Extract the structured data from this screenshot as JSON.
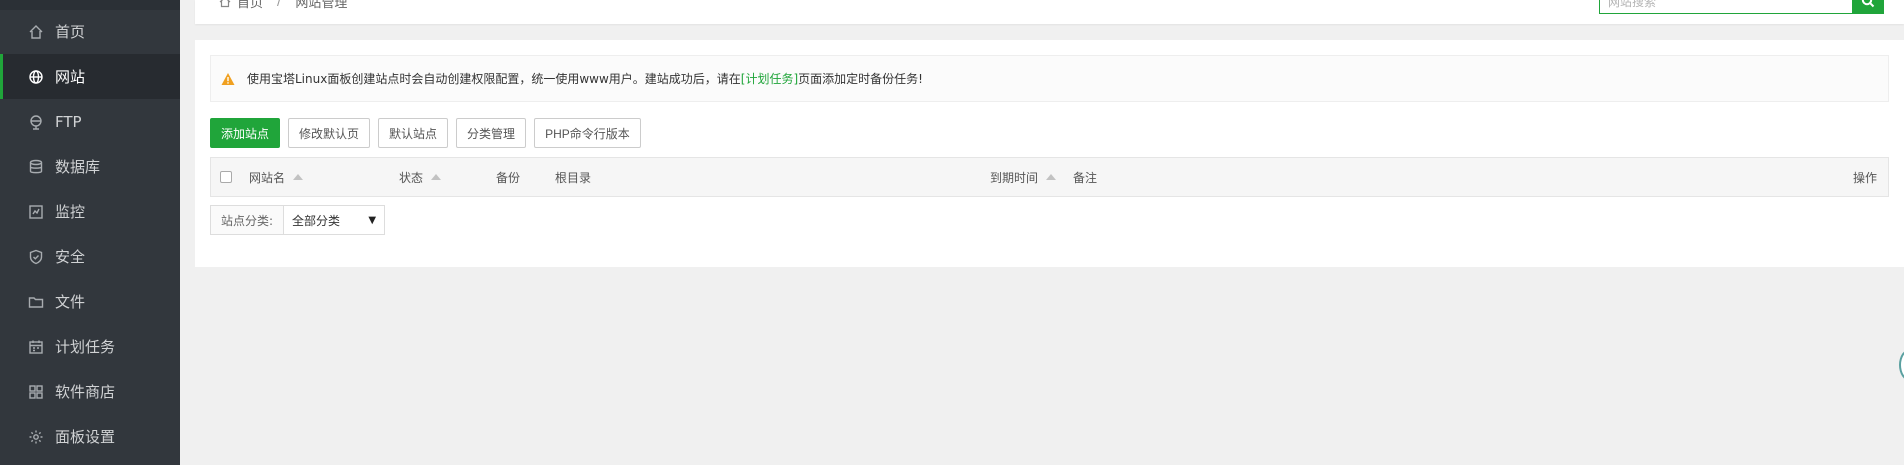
{
  "sidebar": {
    "items": [
      {
        "label": "首页",
        "icon": "home-icon"
      },
      {
        "label": "网站",
        "icon": "globe-icon",
        "active": true
      },
      {
        "label": "FTP",
        "icon": "ftp-icon"
      },
      {
        "label": "数据库",
        "icon": "database-icon"
      },
      {
        "label": "监控",
        "icon": "monitor-icon"
      },
      {
        "label": "安全",
        "icon": "shield-icon"
      },
      {
        "label": "文件",
        "icon": "folder-icon"
      },
      {
        "label": "计划任务",
        "icon": "calendar-icon"
      },
      {
        "label": "软件商店",
        "icon": "apps-grid-icon"
      },
      {
        "label": "面板设置",
        "icon": "gear-icon"
      }
    ]
  },
  "header": {
    "breadcrumb": {
      "home": "首页",
      "separator": "/",
      "current": "网站管理"
    },
    "search": {
      "placeholder": "网站搜索"
    }
  },
  "alert": {
    "text_before": "使用宝塔Linux面板创建站点时会自动创建权限配置，统一使用www用户。建站成功后，请在",
    "link": "[计划任务]",
    "text_after": "页面添加定时备份任务!"
  },
  "toolbar": {
    "add_site": "添加站点",
    "edit_default_page": "修改默认页",
    "default_site": "默认站点",
    "category_manage": "分类管理",
    "php_cli_version": "PHP命令行版本"
  },
  "table": {
    "columns": {
      "site_name": "网站名",
      "status": "状态",
      "backup": "备份",
      "root_dir": "根目录",
      "expire_time": "到期时间",
      "remark": "备注",
      "actions": "操作"
    }
  },
  "filter": {
    "label": "站点分类:",
    "selected": "全部分类"
  },
  "colors": {
    "accent": "#20a53a",
    "sidebar_bg": "#32373d",
    "sidebar_active_bg": "#272b30"
  }
}
